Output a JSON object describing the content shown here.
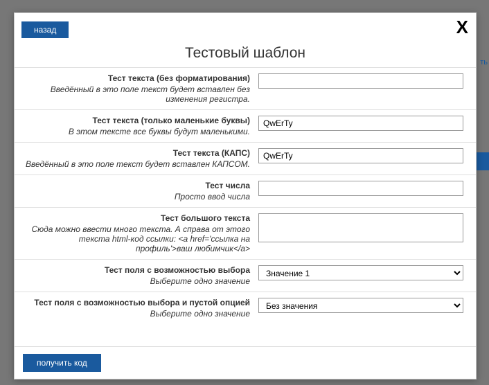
{
  "bg": {
    "right_link": "ть"
  },
  "modal": {
    "back_label": "назад",
    "close_glyph": "X",
    "title": "Тестовый шаблон",
    "submit_label": "получить код"
  },
  "fields": [
    {
      "label": "Тест текста (без форматирования)",
      "help": "Введённый в это поле текст будет вставлен без изменения регистра.",
      "type": "text",
      "value": ""
    },
    {
      "label": "Тест текста (только маленькие буквы)",
      "help": "В этом тексте все буквы будут маленькими.",
      "type": "text",
      "value": "QwErTy"
    },
    {
      "label": "Тест текста (КАПС)",
      "help": "Введённый в это поле текст будет вставлен КАПСОМ.",
      "type": "text",
      "value": "QwErTy"
    },
    {
      "label": "Тест числа",
      "help": "Просто ввод числа",
      "type": "text",
      "value": ""
    },
    {
      "label": "Тест большого текста",
      "help": "Сюда можно ввести много текста. А справа от этого текста html-код ссылки: <a href='ссылка на профиль'>ваш любимчик</a>",
      "type": "textarea",
      "value": ""
    },
    {
      "label": "Тест поля с возможностью выбора",
      "help": "Выберите одно значение",
      "type": "select",
      "value": "Значение 1"
    },
    {
      "label": "Тест поля с возможностью выбора и пустой опцией",
      "help": "Выберите одно значение",
      "type": "select",
      "value": "Без значения"
    }
  ]
}
